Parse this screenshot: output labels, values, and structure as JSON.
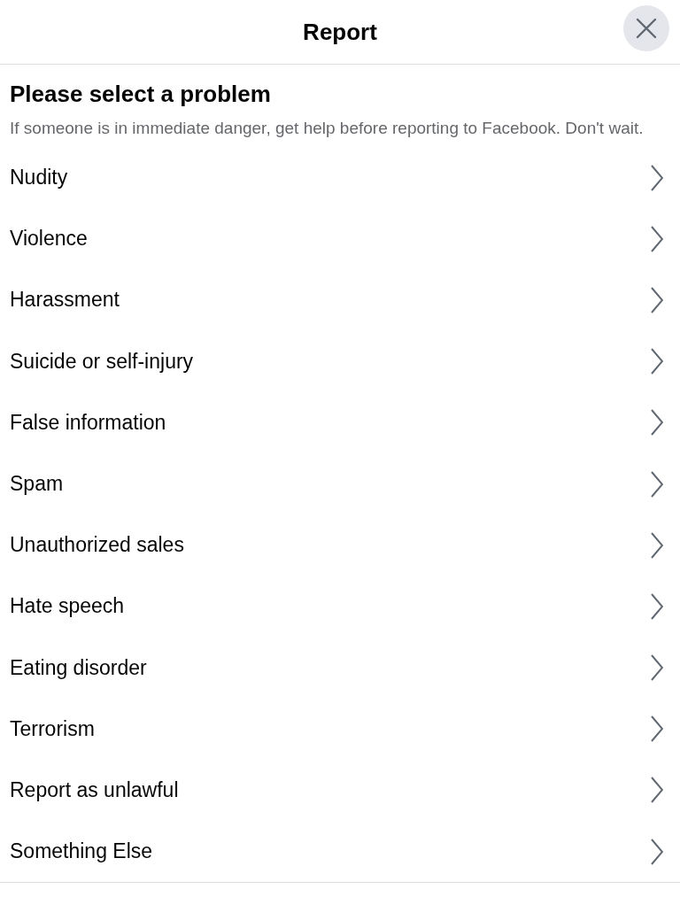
{
  "dialog": {
    "title": "Report"
  },
  "heading": "Please select a problem",
  "description": "If someone is in immediate danger, get help before reporting to Facebook. Don't wait.",
  "problems": [
    {
      "label": "Nudity"
    },
    {
      "label": "Violence"
    },
    {
      "label": "Harassment"
    },
    {
      "label": "Suicide or self-injury"
    },
    {
      "label": "False information"
    },
    {
      "label": "Spam"
    },
    {
      "label": "Unauthorized sales"
    },
    {
      "label": "Hate speech"
    },
    {
      "label": "Eating disorder"
    },
    {
      "label": "Terrorism"
    },
    {
      "label": "Report as unlawful"
    },
    {
      "label": "Something Else"
    }
  ]
}
